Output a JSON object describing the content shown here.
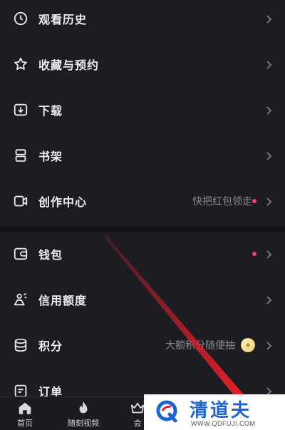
{
  "menu": {
    "items": [
      {
        "label": "观看历史",
        "icon": "clock-icon"
      },
      {
        "label": "收藏与预约",
        "icon": "star-icon"
      },
      {
        "label": "下载",
        "icon": "download-icon"
      },
      {
        "label": "书架",
        "icon": "bookshelf-icon"
      },
      {
        "label": "创作中心",
        "icon": "video-camera-icon",
        "hint": "快把红包领走",
        "dot": true
      },
      {
        "label": "钱包",
        "icon": "wallet-icon",
        "dot": true
      },
      {
        "label": "信用额度",
        "icon": "credit-icon"
      },
      {
        "label": "积分",
        "icon": "coins-stack-icon",
        "hint": "大额积分随便抽",
        "badge": "coin-icon"
      },
      {
        "label": "订单",
        "icon": "order-icon"
      }
    ]
  },
  "tabbar": {
    "tabs": [
      {
        "label": "首页",
        "icon": "home-icon"
      },
      {
        "label": "随刻视频",
        "icon": "flame-icon"
      },
      {
        "label": "会",
        "icon": "crown-icon"
      }
    ]
  },
  "watermark": {
    "title": "清道夫",
    "url": "WWW.QDFUJI.COM"
  },
  "colors": {
    "background": "#1c1c22",
    "accent_dot": "#f0466e",
    "watermark_blue": "#1e63d6",
    "laser_red": "#e8202a"
  }
}
